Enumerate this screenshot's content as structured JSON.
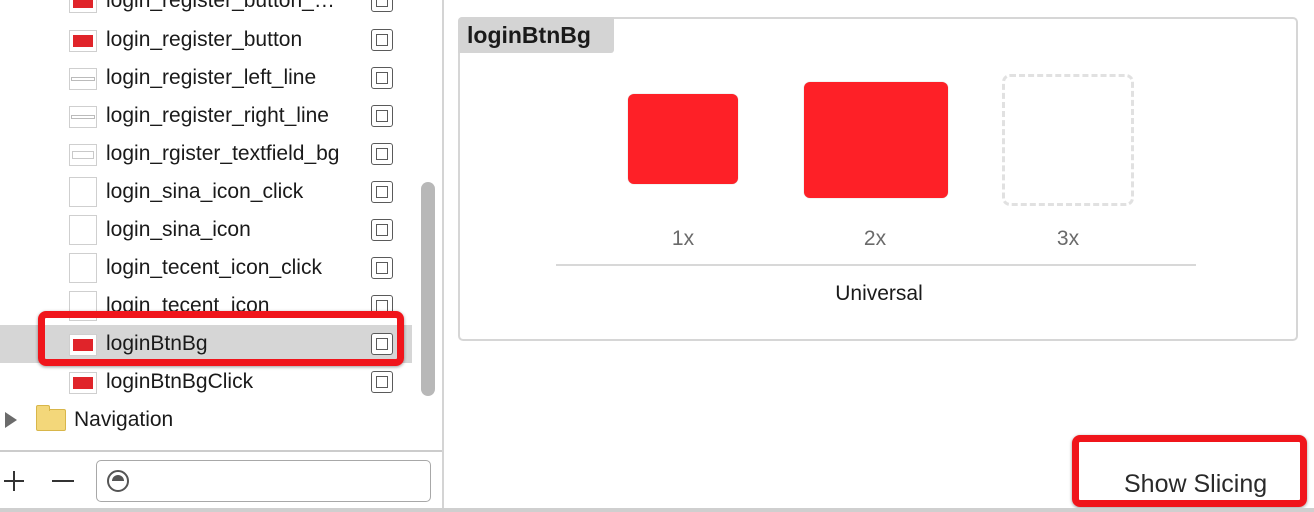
{
  "asset_list": {
    "items": [
      {
        "label": "login_register_button_…",
        "thumb": "red",
        "selected": false
      },
      {
        "label": "login_register_button",
        "thumb": "red",
        "selected": false
      },
      {
        "label": "login_register_left_line",
        "thumb": "line",
        "selected": false
      },
      {
        "label": "login_register_right_line",
        "thumb": "line",
        "selected": false
      },
      {
        "label": "login_rgister_textfield_bg",
        "thumb": "textfield",
        "selected": false
      },
      {
        "label": "login_sina_icon_click",
        "thumb": "blank",
        "selected": false
      },
      {
        "label": "login_sina_icon",
        "thumb": "blank",
        "selected": false
      },
      {
        "label": "login_tecent_icon_click",
        "thumb": "blank",
        "selected": false
      },
      {
        "label": "login_tecent_icon",
        "thumb": "blank",
        "selected": false
      },
      {
        "label": "loginBtnBg",
        "thumb": "red",
        "selected": true
      },
      {
        "label": "loginBtnBgClick",
        "thumb": "red",
        "selected": false
      }
    ],
    "folders": [
      {
        "label": "Navigation",
        "icon": "folder-icon"
      }
    ]
  },
  "bottom_bar": {
    "add_icon": "plus-icon",
    "remove_icon": "minus-icon",
    "filter_icon": "filter-icon",
    "filter_value": ""
  },
  "detail": {
    "set_name": "loginBtnBg",
    "slots": [
      {
        "scale": "1x",
        "filled": true
      },
      {
        "scale": "2x",
        "filled": true
      },
      {
        "scale": "3x",
        "filled": false
      }
    ],
    "idiom": "Universal",
    "show_slicing_label": "Show Slicing"
  },
  "colors": {
    "image_red": "#fe2027",
    "highlight_red": "#f0151b",
    "selection_gray": "#d6d6d6"
  }
}
